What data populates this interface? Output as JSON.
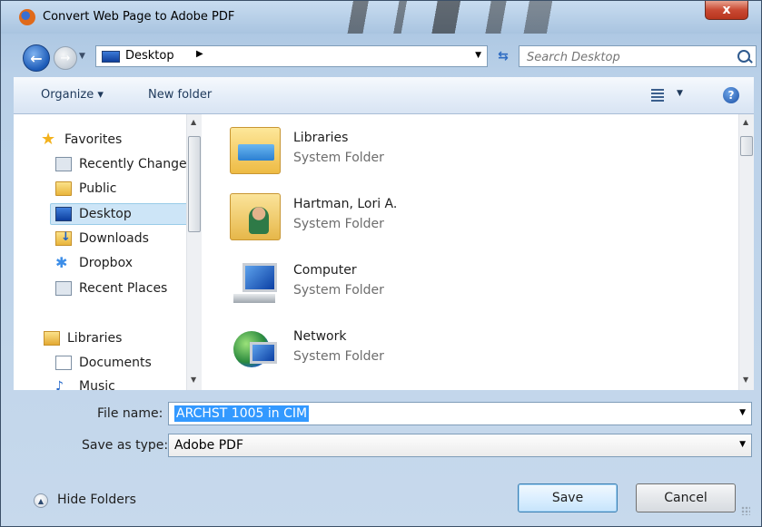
{
  "window": {
    "title": "Convert Web Page to Adobe PDF",
    "close_label": "x"
  },
  "navbar": {
    "location": "Desktop",
    "search_placeholder": "Search Desktop"
  },
  "toolbar": {
    "organize_label": "Organize ▾",
    "new_folder_label": "New folder"
  },
  "sidebar": {
    "items": [
      {
        "label": "Favorites",
        "icon": "star-icon"
      },
      {
        "label": "Recently Changed",
        "icon": "recent-changed-icon"
      },
      {
        "label": "Public",
        "icon": "folder-icon"
      },
      {
        "label": "Desktop",
        "icon": "desktop-icon",
        "selected": true
      },
      {
        "label": "Downloads",
        "icon": "downloads-icon"
      },
      {
        "label": "Dropbox",
        "icon": "dropbox-icon"
      },
      {
        "label": "Recent Places",
        "icon": "recent-places-icon"
      },
      {
        "label": "Libraries",
        "icon": "libraries-icon"
      },
      {
        "label": "Documents",
        "icon": "documents-icon"
      },
      {
        "label": "Music",
        "icon": "music-icon"
      }
    ]
  },
  "content": {
    "items": [
      {
        "name": "Libraries",
        "type": "System Folder",
        "icon": "libraries-folder-icon"
      },
      {
        "name": "Hartman, Lori A.",
        "type": "System Folder",
        "icon": "user-folder-icon"
      },
      {
        "name": "Computer",
        "type": "System Folder",
        "icon": "computer-icon"
      },
      {
        "name": "Network",
        "type": "System Folder",
        "icon": "network-icon"
      }
    ]
  },
  "form": {
    "file_name_label": "File name:",
    "file_name_value": "ARCHST 1005 in CIM",
    "save_type_label": "Save as type:",
    "save_type_value": "Adobe PDF"
  },
  "footer": {
    "hide_folders_label": "Hide Folders",
    "save_label": "Save",
    "cancel_label": "Cancel"
  }
}
